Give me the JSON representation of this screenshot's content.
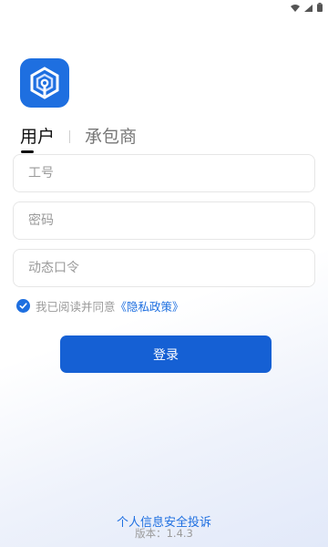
{
  "status_bar": {
    "icons": [
      "wifi-icon",
      "signal-icon",
      "battery-icon"
    ]
  },
  "logo": {
    "icon": "app-logo-icon",
    "color": "#1e6fe0"
  },
  "tabs": [
    {
      "label": "用户",
      "active": true
    },
    {
      "label": "承包商",
      "active": false
    }
  ],
  "form": {
    "employee_id_placeholder": "工号",
    "password_placeholder": "密码",
    "otp_placeholder": "动态口令"
  },
  "agreement": {
    "checked": true,
    "text": "我已阅读并同意",
    "policy_link": "《隐私政策》"
  },
  "login_button": "登录",
  "footer": {
    "complaint_link": "个人信息安全投诉",
    "version": "版本：1.4.3"
  },
  "colors": {
    "accent": "#1e6fe0",
    "button": "#1560d4"
  }
}
